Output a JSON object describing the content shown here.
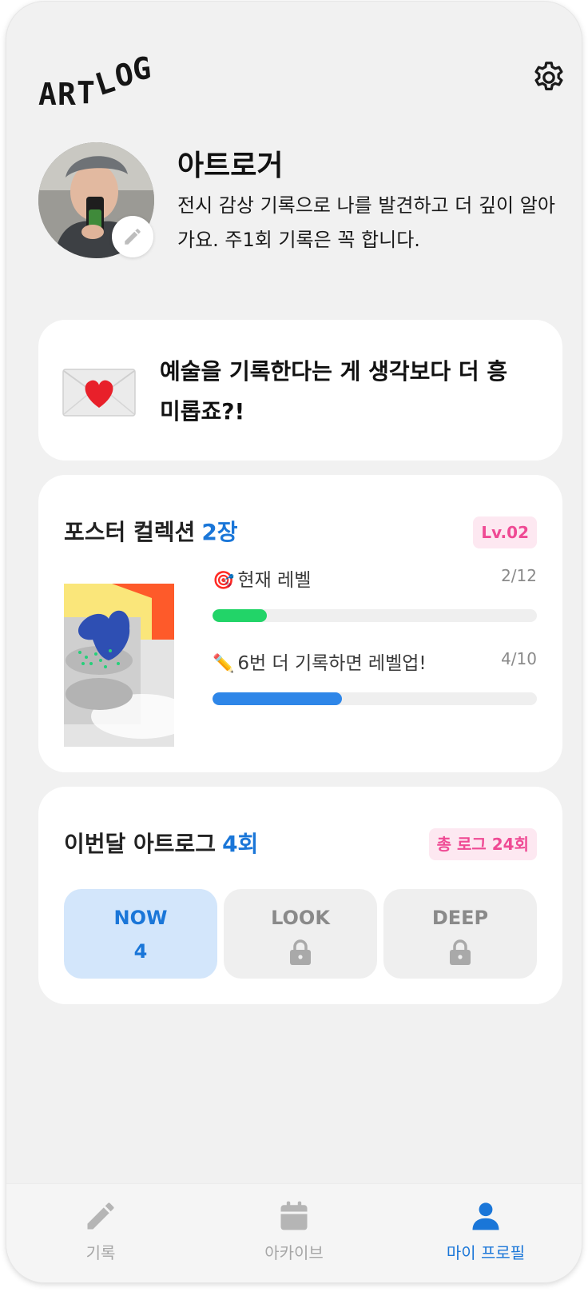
{
  "header": {
    "logo_letters": [
      "A",
      "R",
      "T",
      "L",
      "O",
      "G"
    ],
    "settings_icon": "gear-icon"
  },
  "profile": {
    "name": "아트로거",
    "bio": "전시 감상 기록으로 나를 발견하고 더 깊이 알아가요. 주1회 기록은 꼭 합니다.",
    "edit_icon": "pencil-icon"
  },
  "quote": {
    "icon": "love-letter-icon",
    "text": "예술을 기록한다는 게 생각보다 더 흥미롭죠?!"
  },
  "poster_collection": {
    "title": "포스터 컬렉션",
    "count": "2장",
    "level_badge": "Lv.02",
    "progress": [
      {
        "emoji": "🎯",
        "label": "현재 레벨",
        "value_text": "2/12",
        "fraction": 0.1667,
        "color": "#22d468"
      },
      {
        "emoji": "✏️",
        "label": "6번 더 기록하면 레벨업!",
        "value_text": "4/10",
        "fraction": 0.4,
        "color": "#2e86e8"
      }
    ]
  },
  "monthly_log": {
    "title": "이번달 아트로그",
    "count": "4회",
    "total_badge": "총 로그 24회",
    "tiles": [
      {
        "label": "NOW",
        "value": "4",
        "locked": false
      },
      {
        "label": "LOOK",
        "value": "",
        "locked": true
      },
      {
        "label": "DEEP",
        "value": "",
        "locked": true
      }
    ]
  },
  "bottom_nav": {
    "items": [
      {
        "label": "기록",
        "icon": "pencil-icon",
        "active": false
      },
      {
        "label": "아카이브",
        "icon": "calendar-icon",
        "active": false
      },
      {
        "label": "마이 프로필",
        "icon": "person-icon",
        "active": true
      }
    ]
  },
  "colors": {
    "accent": "#1a76d8",
    "pink": "#ef4a94",
    "background": "#f1f1f1"
  }
}
